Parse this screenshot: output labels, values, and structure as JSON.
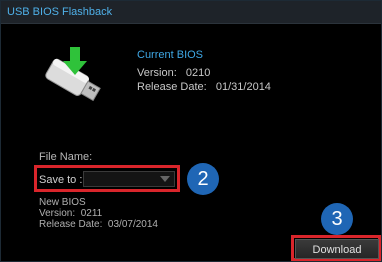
{
  "window": {
    "title": "USB BIOS Flashback"
  },
  "current_bios": {
    "heading": "Current BIOS",
    "version_line": "Version:   0210",
    "release_line": "Release Date:   01/31/2014"
  },
  "file_name_label": "File Name:",
  "save_to": {
    "label": "Save to :",
    "value": ""
  },
  "new_bios": {
    "heading": "New BIOS",
    "version_line": "Version:  0211",
    "release_line": "Release Date:  03/07/2014"
  },
  "download_label": "Download",
  "callouts": {
    "two": "2",
    "three": "3"
  },
  "colors": {
    "accent": "#3fa8e6",
    "highlight": "#d9252b",
    "badge": "#1f66b5"
  },
  "icons": {
    "usb": "usb-drive-icon",
    "arrow": "download-arrow-icon"
  }
}
